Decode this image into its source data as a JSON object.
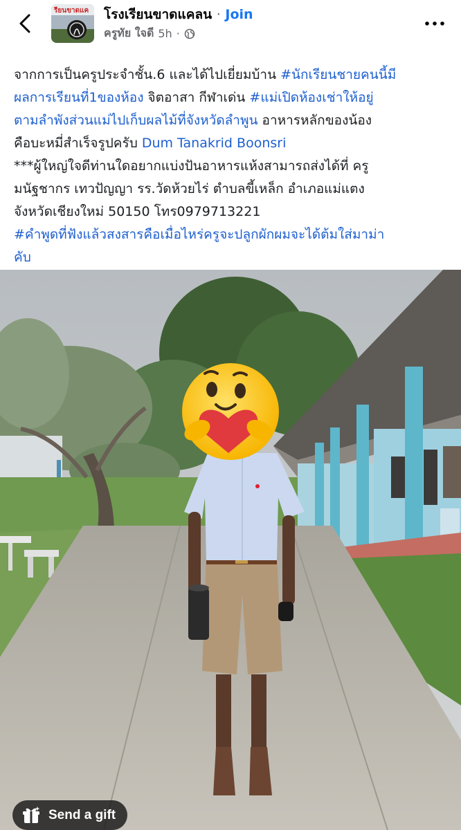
{
  "header": {
    "group_name": "โรงเรียนขาดแคลน",
    "separator": "·",
    "join_label": "Join",
    "author": "ครูทัย ใจดี",
    "time": "5h",
    "time_sep": "·",
    "avatar_text": "รียนขาดแค"
  },
  "post": {
    "lines": [
      [
        {
          "t": "จากการเป็นครูประจำชั้น.6 และได้ไปเยี่ยมบ้าน "
        },
        {
          "t": "#นักเรียนชายคนนี้มี",
          "c": "hash"
        }
      ],
      [
        {
          "t": "ผลการเรียนที่1ของห้อง",
          "c": "hash"
        },
        {
          "t": " จิตอาสา กีฬาเด่น "
        },
        {
          "t": "#แม่เปิดห้องเช่าให้อยู่",
          "c": "hash"
        }
      ],
      [
        {
          "t": "ตามลำพังส่วนแม่ไปเก็บผลไม้ที่จังหวัดลำพูน",
          "c": "hash"
        },
        {
          "t": " อาหารหลักของน้อง"
        }
      ],
      [
        {
          "t": "คือบะหมี่สำเร็จรูปครับ "
        },
        {
          "t": "Dum Tanakrid Boonsri",
          "c": "mention"
        }
      ],
      [
        {
          "t": "***ผู้ใหญ่ใจดีท่านใดอยากแบ่งปันอาหารแห้งสามารถส่งได้ที่ ครู"
        }
      ],
      [
        {
          "t": "มนัฐชากร เทวปัญญา รร.วัดห้วยไร่ ตำบลขี้เหล็ก อำเภอแม่แตง"
        }
      ],
      [
        {
          "t": "จังหวัดเชียงใหม่ 50150 โทร0979713221"
        }
      ],
      [
        {
          "t": "#คำพูดที่ฟังแล้วสงสารคือเมื่อไหร่ครูจะปลูกผักผมจะได้ต้มใส่มาม่า",
          "c": "hash"
        }
      ],
      [
        {
          "t": "คับ",
          "c": "hash"
        }
      ]
    ]
  },
  "gift": {
    "label": "Send a gift"
  },
  "colors": {
    "link": "#1d5fcf",
    "join": "#1877f2",
    "meta": "#65676b"
  },
  "icons": [
    "back-arrow-icon",
    "globe-icon",
    "more-options-icon",
    "gift-icon",
    "care-emoji-icon"
  ]
}
